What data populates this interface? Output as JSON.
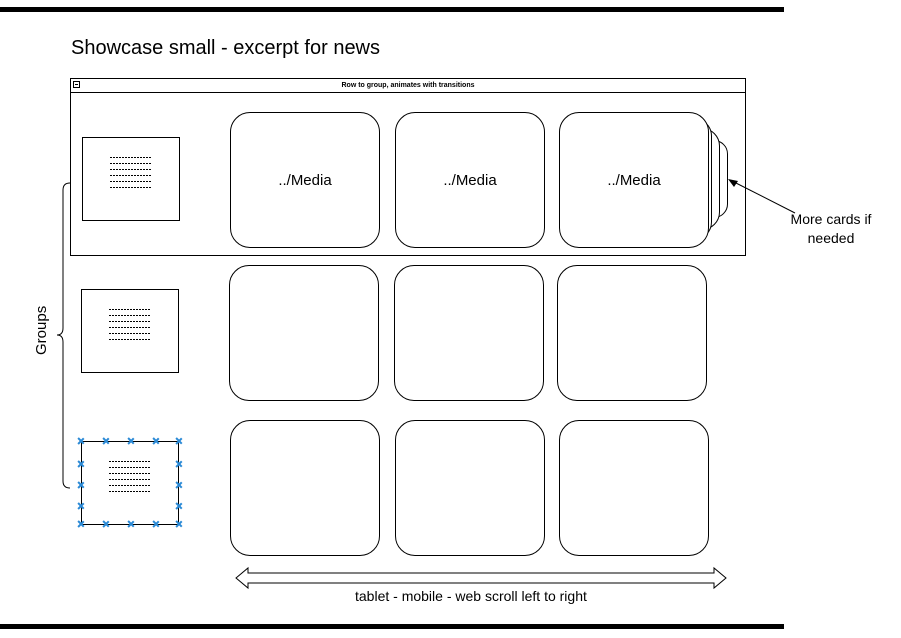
{
  "page": {
    "title": "Showcase small - excerpt for news"
  },
  "group_row": {
    "header": "Row to group, animates with transitions"
  },
  "rows": [
    {
      "cards": [
        "../Media",
        "../Media",
        "../Media"
      ]
    },
    {
      "cards": [
        "",
        "",
        ""
      ]
    },
    {
      "cards": [
        "",
        "",
        ""
      ]
    }
  ],
  "annotations": {
    "more_cards": "More cards if needed",
    "groups": "Groups",
    "scroll": "tablet - mobile - web scroll left to right"
  },
  "colors": {
    "selection_handle": "#2b8ad6",
    "stroke": "#000000"
  }
}
